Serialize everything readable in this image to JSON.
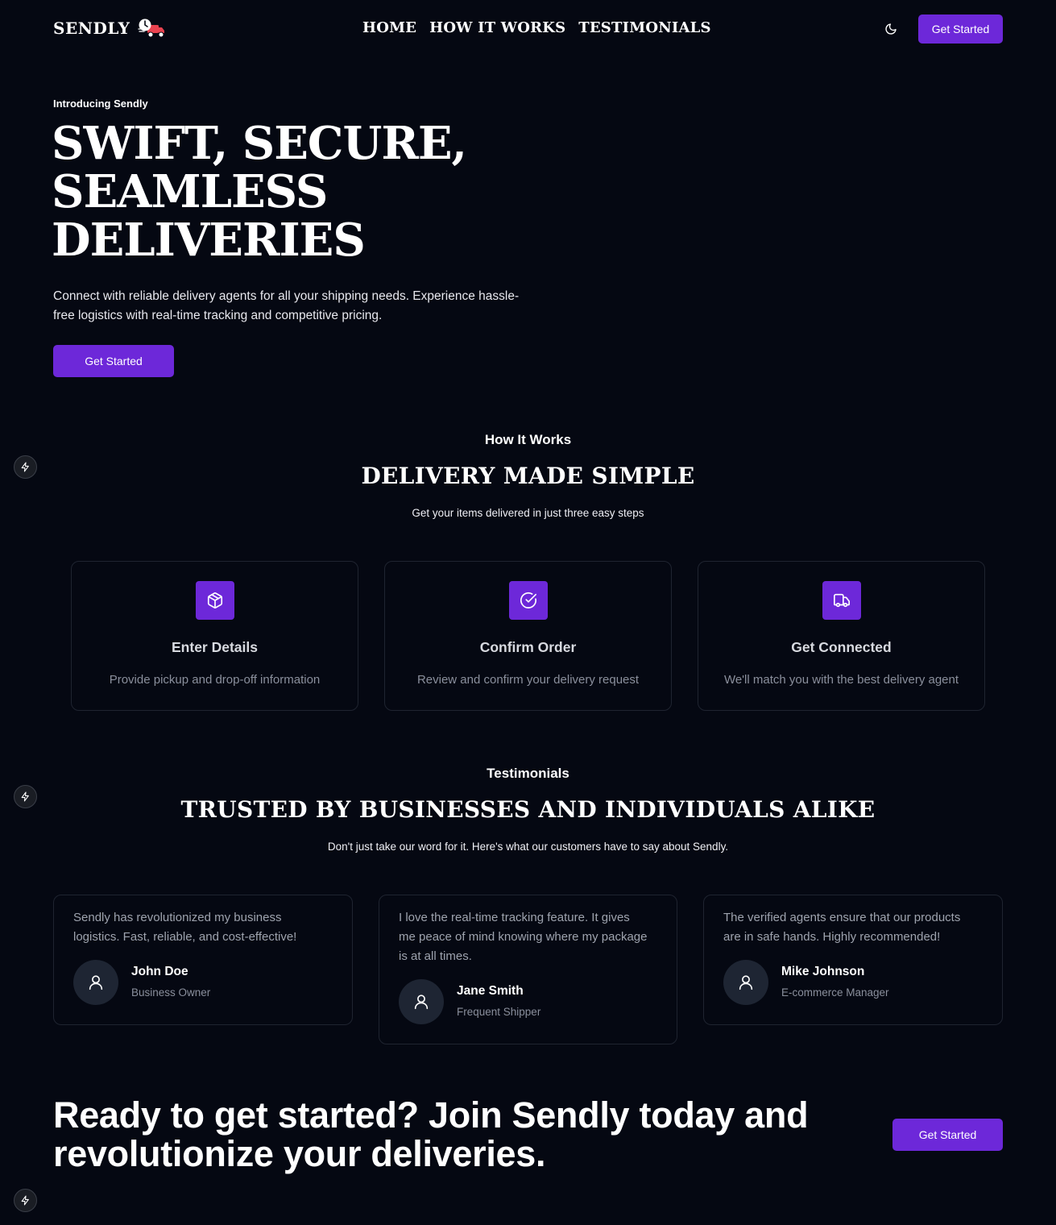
{
  "brand": {
    "name": "SENDLY",
    "icon": "delivery-truck-icon"
  },
  "nav": {
    "links": [
      "HOME",
      "HOW IT WORKS",
      "TESTIMONIALS"
    ],
    "theme_icon": "moon-icon",
    "cta": "Get Started"
  },
  "hero": {
    "eyebrow": "Introducing Sendly",
    "title_lines": [
      "SWIFT, SECURE,",
      "SEAMLESS",
      "DELIVERIES"
    ],
    "description": "Connect with reliable delivery agents for all your shipping needs. Experience hassle-free logistics with real-time tracking and competitive pricing.",
    "cta": "Get Started"
  },
  "how_it_works": {
    "eyebrow": "How It Works",
    "title": "DELIVERY MADE SIMPLE",
    "subtitle": "Get your items delivered in just three easy steps",
    "steps": [
      {
        "icon": "package-icon",
        "title": "Enter Details",
        "description": "Provide pickup and drop-off information"
      },
      {
        "icon": "check-circle-icon",
        "title": "Confirm Order",
        "description": "Review and confirm your delivery request"
      },
      {
        "icon": "truck-icon",
        "title": "Get Connected",
        "description": "We'll match you with the best delivery agent"
      }
    ]
  },
  "testimonials": {
    "eyebrow": "Testimonials",
    "title": "TRUSTED BY BUSINESSES AND INDIVIDUALS ALIKE",
    "subtitle": "Don't just take our word for it. Here's what our customers have to say about Sendly.",
    "items": [
      {
        "quote": "Sendly has revolutionized my business logistics. Fast, reliable, and cost-effective!",
        "name": "John Doe",
        "role": "Business Owner"
      },
      {
        "quote": "I love the real-time tracking feature. It gives me peace of mind knowing where my package is at all times.",
        "name": "Jane Smith",
        "role": "Frequent Shipper"
      },
      {
        "quote": "The verified agents ensure that our products are in safe hands. Highly recommended!",
        "name": "Mike Johnson",
        "role": "E-commerce Manager"
      }
    ]
  },
  "cta": {
    "title": "Ready to get started? Join Sendly today and revolutionize your deliveries.",
    "button": "Get Started"
  },
  "colors": {
    "background": "#050812",
    "accent": "#6d28d9",
    "card_border": "#1f2430"
  }
}
